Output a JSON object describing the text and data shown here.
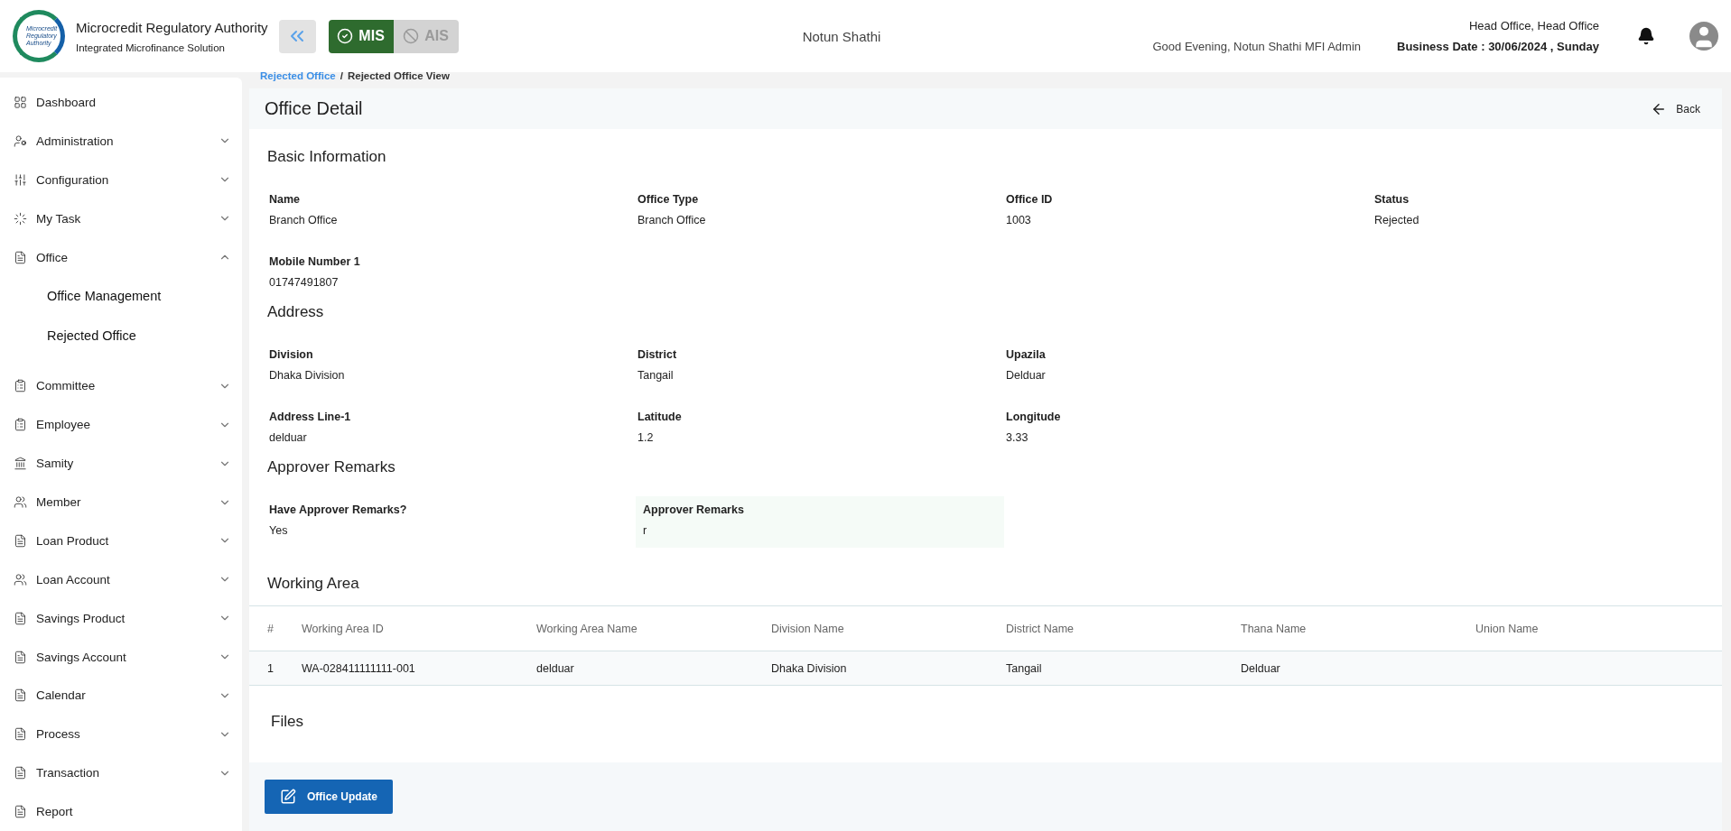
{
  "header": {
    "logo_lines": [
      "Microcredit",
      "Regulatory",
      "Authority"
    ],
    "title": "Microcredit Regulatory Authority",
    "subtitle": "Integrated Microfinance Solution",
    "modules": [
      {
        "label": "MIS",
        "selected": true
      },
      {
        "label": "AIS",
        "selected": false
      }
    ],
    "organization": "Notun Shathi",
    "greeting": "Good Evening, Notun Shathi MFI Admin",
    "office": "Head Office, Head Office",
    "business_date": "Business Date : 30/06/2024 , Sunday"
  },
  "breadcrumb": {
    "items": [
      "Rejected Office",
      "Rejected Office View"
    ],
    "separator": "/"
  },
  "sidebar": {
    "items": [
      {
        "label": "Dashboard",
        "kind": "link"
      },
      {
        "label": "Administration",
        "kind": "group",
        "expanded": false
      },
      {
        "label": "Configuration",
        "kind": "group",
        "expanded": false
      },
      {
        "label": "My Task",
        "kind": "group",
        "expanded": false
      },
      {
        "label": "Office",
        "kind": "group",
        "expanded": true,
        "children": [
          {
            "label": "Office Management"
          },
          {
            "label": "Rejected Office"
          }
        ]
      },
      {
        "label": "Committee",
        "kind": "group",
        "expanded": false
      },
      {
        "label": "Employee",
        "kind": "group",
        "expanded": false
      },
      {
        "label": "Samity",
        "kind": "group",
        "expanded": false
      },
      {
        "label": "Member",
        "kind": "group",
        "expanded": false
      },
      {
        "label": "Loan Product",
        "kind": "group",
        "expanded": false
      },
      {
        "label": "Loan Account",
        "kind": "group",
        "expanded": false
      },
      {
        "label": "Savings Product",
        "kind": "group",
        "expanded": false
      },
      {
        "label": "Savings Account",
        "kind": "group",
        "expanded": false
      },
      {
        "label": "Calendar",
        "kind": "group",
        "expanded": false
      },
      {
        "label": "Process",
        "kind": "group",
        "expanded": false
      },
      {
        "label": "Transaction",
        "kind": "group",
        "expanded": false
      },
      {
        "label": "Report",
        "kind": "link"
      }
    ]
  },
  "page": {
    "title": "Office Detail",
    "back": "Back",
    "sections": [
      {
        "title": "Basic Information",
        "rows": [
          [
            {
              "label": "Name",
              "value": "Branch Office"
            },
            {
              "label": "Office Type",
              "value": "Branch Office"
            },
            {
              "label": "Office ID",
              "value": "1003"
            },
            {
              "label": "Status",
              "value": "Rejected"
            }
          ],
          [
            {
              "label": "Mobile Number 1",
              "value": "01747491807"
            }
          ]
        ]
      },
      {
        "title": "Address",
        "rows": [
          [
            {
              "label": "Division",
              "value": "Dhaka Division"
            },
            {
              "label": "District",
              "value": "Tangail"
            },
            {
              "label": "Upazila",
              "value": "Delduar"
            }
          ],
          [
            {
              "label": "Address Line-1",
              "value": "delduar"
            },
            {
              "label": "Latitude",
              "value": "1.2"
            },
            {
              "label": "Longitude",
              "value": "3.33"
            }
          ]
        ]
      },
      {
        "title": "Approver Remarks",
        "rows": [
          [
            {
              "label": "Have Approver Remarks?",
              "value": "Yes",
              "kind": "plain"
            },
            {
              "label": "Approver Remarks",
              "value": "r",
              "kind": "boxed"
            }
          ]
        ]
      }
    ],
    "working_area": {
      "title": "Working Area",
      "columns": [
        "#",
        "Working Area ID",
        "Working Area Name",
        "Division Name",
        "District Name",
        "Thana Name",
        "Union Name"
      ],
      "rows": [
        [
          "1",
          "WA-028411111111-001",
          "delduar",
          "Dhaka Division",
          "Tangail",
          "Delduar",
          ""
        ]
      ]
    },
    "files_title": "Files",
    "update_button": "Office Update"
  }
}
